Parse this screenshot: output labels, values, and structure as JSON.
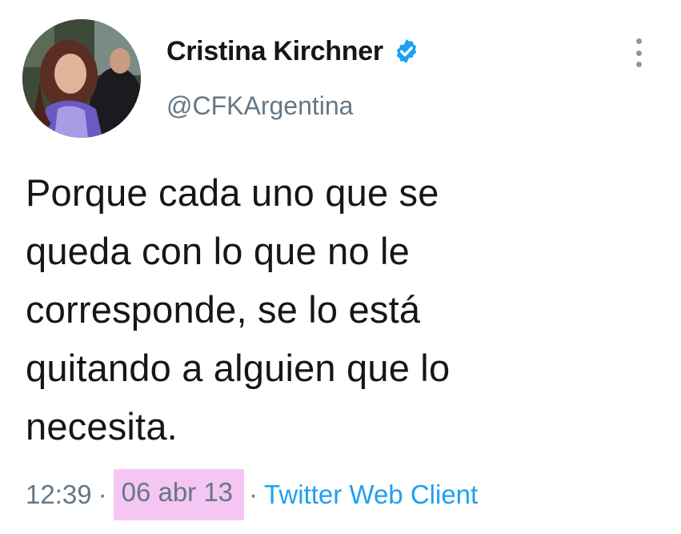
{
  "author": {
    "display_name": "Cristina Kirchner",
    "handle": "@CFKArgentina",
    "verified": true
  },
  "tweet": {
    "text_lines": [
      "Porque cada uno que se",
      "queda con lo que no le",
      "corresponde, se lo está",
      "quitando a alguien que lo",
      "necesita."
    ],
    "time": "12:39",
    "separator": "·",
    "date": "06 abr 13",
    "client": "Twitter Web Client"
  },
  "icons": {
    "verified": "verified-badge-icon",
    "more": "more-options-icon"
  },
  "colors": {
    "verified_blue": "#1da1f2",
    "link_blue": "#1da1f2",
    "secondary_text": "#657786",
    "highlight": "#f5c6f3"
  }
}
